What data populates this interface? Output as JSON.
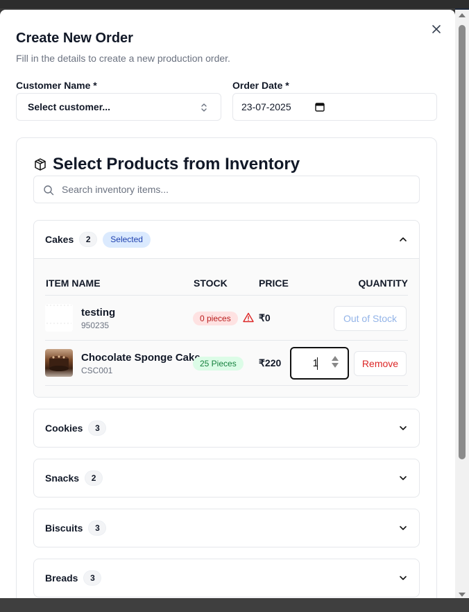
{
  "modal": {
    "title": "Create New Order",
    "subtitle": "Fill in the details to create a new production order."
  },
  "form": {
    "customer_label": "Customer Name *",
    "customer_value": "Select customer...",
    "date_label": "Order Date *",
    "date_value": "23-07-2025"
  },
  "inventory": {
    "title": "Select Products from Inventory",
    "search_placeholder": "Search inventory items...",
    "columns": [
      "ITEM NAME",
      "STOCK",
      "PRICE",
      "QUANTITY"
    ],
    "categories": [
      {
        "name": "Cakes",
        "count": "2",
        "badge": "Selected",
        "expanded": true,
        "items": [
          {
            "name": "testing",
            "code": "950235",
            "stock": "0 pieces",
            "price": "₹0",
            "action": "Out of Stock"
          },
          {
            "name": "Chocolate Sponge Cake",
            "code": "CSC001",
            "stock": "25 Pieces",
            "price": "₹220",
            "quantity": "1",
            "action": "Remove"
          }
        ]
      },
      {
        "name": "Cookies",
        "count": "3"
      },
      {
        "name": "Snacks",
        "count": "2"
      },
      {
        "name": "Biscuits",
        "count": "3"
      },
      {
        "name": "Breads",
        "count": "3"
      }
    ]
  },
  "colors": {
    "selected_badge_bg": "#dbeafe",
    "out_of_stock_badge_bg": "#fee2e2",
    "in_stock_badge_bg": "#dcfce7",
    "remove_text": "#dc2626"
  },
  "icons": [
    "close-icon",
    "chevron-updown-icon",
    "calendar-icon",
    "package-icon",
    "search-icon",
    "chevron-up-icon",
    "chevron-down-icon",
    "warning-icon"
  ]
}
